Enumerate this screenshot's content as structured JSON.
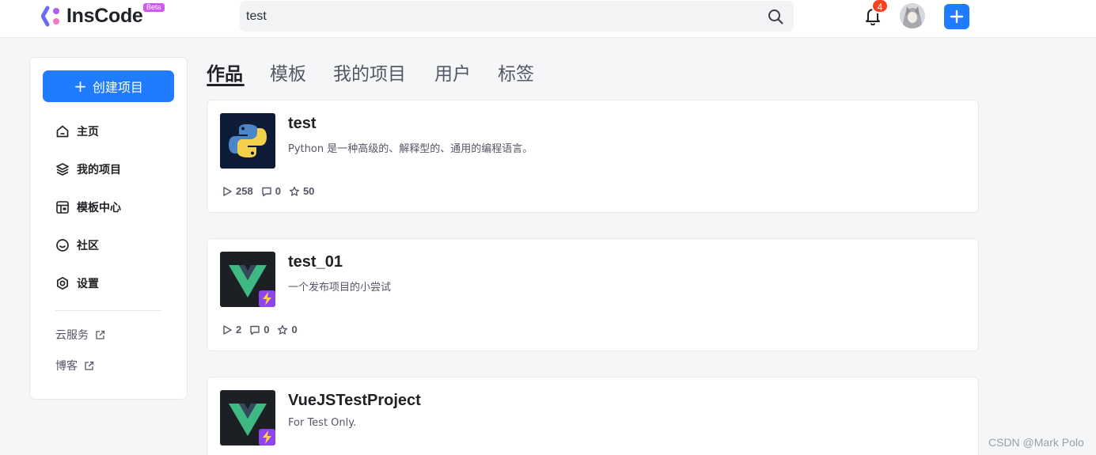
{
  "header": {
    "brand": "InsCode",
    "beta_label": "Beta",
    "search_value": "test",
    "notification_count": "4",
    "accent_color": "#1f7cff"
  },
  "sidebar": {
    "create_button": "创建项目",
    "nav": [
      {
        "label": "主页",
        "icon": "home-icon"
      },
      {
        "label": "我的项目",
        "icon": "layers-icon"
      },
      {
        "label": "模板中心",
        "icon": "template-icon"
      },
      {
        "label": "社区",
        "icon": "smile-icon"
      },
      {
        "label": "设置",
        "icon": "gear-icon"
      }
    ],
    "links": [
      {
        "label": "云服务",
        "icon": "external-link-icon"
      },
      {
        "label": "博客",
        "icon": "external-link-icon"
      }
    ]
  },
  "tabs": [
    "作品",
    "模板",
    "我的项目",
    "用户",
    "标签"
  ],
  "active_tab": "作品",
  "projects": [
    {
      "title": "test",
      "description": "Python 是一种高级的、解释型的、通用的编程语言。",
      "runs": "258",
      "comments": "0",
      "stars": "50",
      "icon": "python-logo-icon"
    },
    {
      "title": "test_01",
      "description": "一个发布项目的小尝试",
      "runs": "2",
      "comments": "0",
      "stars": "0",
      "icon": "vue-logo-icon"
    },
    {
      "title": "VueJSTestProject",
      "description": "For Test Only.",
      "icon": "vue-logo-icon"
    }
  ],
  "watermark": "CSDN @Mark Polo"
}
